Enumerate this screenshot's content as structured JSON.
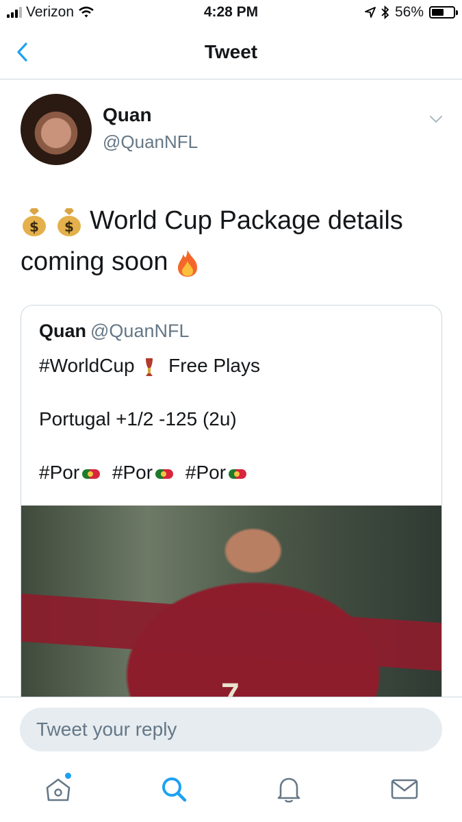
{
  "status_bar": {
    "carrier": "Verizon",
    "time": "4:28 PM",
    "battery": "56%",
    "battery_level": 0.56,
    "icons": [
      "signal-icon",
      "wifi-icon",
      "location-arrow-icon",
      "bluetooth-icon",
      "battery-icon"
    ]
  },
  "nav": {
    "title": "Tweet",
    "back_icon": "chevron-left-icon"
  },
  "tweet": {
    "author_name": "Quan",
    "author_handle": "@QuanNFL",
    "text_part1": "World Cup Package details",
    "text_part2": "coming soon",
    "emojis": [
      "money-bag-icon",
      "money-bag-icon",
      "fire-icon"
    ],
    "menu_icon": "chevron-down-icon"
  },
  "quoted_tweet": {
    "author_name": "Quan",
    "author_handle": "@QuanNFL",
    "line1": "#WorldCup",
    "line1_suffix": "Free Plays",
    "line2": "Portugal +1/2 -125 (2u)",
    "hashtag": "#Por",
    "photo_jersey_number": "7"
  },
  "reply": {
    "placeholder": "Tweet your reply"
  },
  "tab_bar": {
    "tabs": [
      "home-icon",
      "search-icon",
      "notifications-icon",
      "messages-icon"
    ]
  },
  "colors": {
    "accent": "#1da1f2",
    "text": "#14171a",
    "muted": "#657786",
    "reply_bg": "#e6ecf0"
  }
}
